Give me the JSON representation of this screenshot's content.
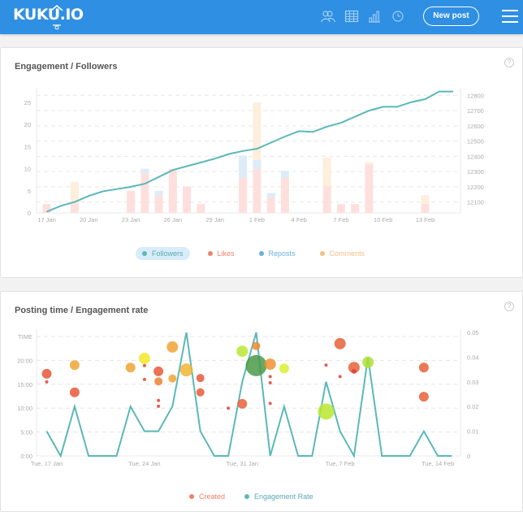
{
  "header": {
    "logo": "KUKU.IO",
    "nav_icons": [
      "users-icon",
      "calendar-icon",
      "analytics-icon",
      "clock-icon"
    ],
    "new_post_label": "New post",
    "menu_icon": "hamburger-menu-icon",
    "brand_color": "#2e8fe3"
  },
  "cards": [
    {
      "title": "Engagement / Followers",
      "help": "?"
    },
    {
      "title": "Posting time / Engagement rate",
      "help": "?"
    }
  ],
  "chart_data": [
    {
      "type": "bar",
      "title": "Engagement / Followers",
      "x_tick_labels": [
        "17 Jan",
        "20 Jan",
        "23 Jan",
        "26 Jan",
        "29 Jan",
        "1 Feb",
        "4 Feb",
        "7 Feb",
        "10 Feb",
        "13 Feb"
      ],
      "categories": [
        "17 Jan",
        "18 Jan",
        "19 Jan",
        "20 Jan",
        "21 Jan",
        "22 Jan",
        "23 Jan",
        "24 Jan",
        "25 Jan",
        "26 Jan",
        "27 Jan",
        "28 Jan",
        "29 Jan",
        "30 Jan",
        "31 Jan",
        "1 Feb",
        "2 Feb",
        "3 Feb",
        "4 Feb",
        "5 Feb",
        "6 Feb",
        "7 Feb",
        "8 Feb",
        "9 Feb",
        "10 Feb",
        "11 Feb",
        "12 Feb",
        "13 Feb",
        "14 Feb",
        "15 Feb"
      ],
      "y_left": {
        "ticks": [
          0,
          5,
          10,
          15,
          20,
          25
        ],
        "range": [
          0,
          27
        ]
      },
      "y_right": {
        "ticks": [
          12100,
          12200,
          12300,
          12400,
          12500,
          12600,
          12700,
          12800
        ],
        "range": [
          12030,
          12830
        ]
      },
      "grid": true,
      "series": [
        {
          "name": "Followers",
          "kind": "line",
          "axis": "right",
          "color": "#5bb8b8",
          "values": [
            12036,
            12075,
            12100,
            12140,
            12170,
            12185,
            12200,
            12220,
            12265,
            12310,
            12335,
            12360,
            12385,
            12415,
            12435,
            12450,
            12490,
            12530,
            12565,
            12560,
            12595,
            12620,
            12660,
            12700,
            12725,
            12725,
            12755,
            12775,
            12825,
            12825
          ]
        },
        {
          "name": "Likes",
          "kind": "stacked-bar",
          "axis": "left",
          "color": "#f08a80",
          "values": [
            2,
            0,
            2,
            0,
            0,
            0,
            5,
            9,
            4,
            10,
            6,
            2,
            0,
            0,
            8,
            10,
            3.5,
            8,
            0,
            0,
            6,
            2,
            2,
            11,
            0,
            0,
            0,
            2,
            0,
            0
          ]
        },
        {
          "name": "Reposts",
          "kind": "stacked-bar",
          "axis": "left",
          "color": "#7ab8e0",
          "values": [
            0,
            0,
            0,
            0,
            0,
            0,
            0,
            1,
            1,
            0,
            0,
            0,
            0,
            0,
            5,
            2,
            1,
            1.5,
            0,
            0,
            0,
            0,
            0,
            0,
            0,
            0,
            0,
            0,
            0,
            0
          ]
        },
        {
          "name": "Comments",
          "kind": "stacked-bar",
          "axis": "left",
          "color": "#f5c080",
          "values": [
            0,
            0,
            5,
            0,
            0,
            0,
            0,
            0,
            0,
            0,
            0,
            0,
            0,
            0,
            0,
            13,
            0,
            0,
            0,
            0,
            6.5,
            0,
            0,
            0.5,
            0,
            0,
            0,
            2,
            0,
            0
          ]
        }
      ],
      "legend": [
        {
          "label": "Followers",
          "color": "#5bb8b8",
          "text_color": "#5aa8b8",
          "active": true
        },
        {
          "label": "Likes",
          "color": "#f0806a",
          "text_color": "#f0806a",
          "active": false
        },
        {
          "label": "Reposts",
          "color": "#6ab0e0",
          "text_color": "#6ab0e0",
          "active": false
        },
        {
          "label": "Comments",
          "color": "#f5c080",
          "text_color": "#f5c080",
          "active": false
        }
      ],
      "legend_position": "bottom-center"
    },
    {
      "type": "scatter",
      "title": "Posting time / Engagement rate",
      "x_tick_labels": [
        "Tue, 17 Jan",
        "Tue, 24 Jan",
        "Tue, 31 Jan",
        "Tue, 7 Feb",
        "Tue, 14 Feb"
      ],
      "y_left": {
        "label": "TIME",
        "ticks": [
          "0:00",
          "5:00",
          "10:00",
          "15:00",
          "20:00"
        ],
        "range_hours": [
          0,
          25
        ]
      },
      "y_right": {
        "ticks": [
          "0",
          "0.01",
          "0.02",
          "0.03",
          "0.04",
          "0.05"
        ],
        "range": [
          0,
          0.05
        ]
      },
      "grid": true,
      "engagement_rate": {
        "name": "Engagement Rate",
        "color": "#5bb8b8",
        "days": [
          "17 Jan",
          "18 Jan",
          "19 Jan",
          "20 Jan",
          "21 Jan",
          "22 Jan",
          "23 Jan",
          "24 Jan",
          "25 Jan",
          "26 Jan",
          "27 Jan",
          "28 Jan",
          "29 Jan",
          "30 Jan",
          "31 Jan",
          "1 Feb",
          "2 Feb",
          "3 Feb",
          "4 Feb",
          "5 Feb",
          "6 Feb",
          "7 Feb",
          "8 Feb",
          "9 Feb",
          "10 Feb",
          "11 Feb",
          "12 Feb",
          "13 Feb",
          "14 Feb",
          "15 Feb"
        ],
        "values": [
          0.01,
          0,
          0.02,
          0,
          0,
          0,
          0.02,
          0.01,
          0.01,
          0.02,
          0.05,
          0.01,
          0,
          0,
          0.03,
          0.05,
          0,
          0.02,
          0,
          0,
          0.03,
          0.01,
          0,
          0.04,
          0,
          0,
          0,
          0.01,
          0,
          0
        ]
      },
      "created_posts": [
        {
          "day": 0,
          "hour": 17.2,
          "size": 3,
          "color": "#e8553a"
        },
        {
          "day": 0,
          "hour": 15.5,
          "size": 1,
          "color": "#d9443a"
        },
        {
          "day": 2,
          "hour": 19.0,
          "size": 3,
          "color": "#f0a535"
        },
        {
          "day": 2,
          "hour": 13.3,
          "size": 3,
          "color": "#e8583a"
        },
        {
          "day": 6,
          "hour": 18.5,
          "size": 3,
          "color": "#f0a535"
        },
        {
          "day": 7,
          "hour": 20.4,
          "size": 3.5,
          "color": "#f2e826"
        },
        {
          "day": 7,
          "hour": 18.9,
          "size": 1,
          "color": "#d9443a"
        },
        {
          "day": 7,
          "hour": 16.0,
          "size": 1,
          "color": "#d9443a"
        },
        {
          "day": 8,
          "hour": 17.7,
          "size": 3,
          "color": "#e8583a"
        },
        {
          "day": 8,
          "hour": 15.6,
          "size": 2.5,
          "color": "#f08030"
        },
        {
          "day": 8,
          "hour": 11.6,
          "size": 1,
          "color": "#d9443a"
        },
        {
          "day": 8,
          "hour": 10.4,
          "size": 1,
          "color": "#d9443a"
        },
        {
          "day": 9,
          "hour": 22.8,
          "size": 3.5,
          "color": "#f0a535"
        },
        {
          "day": 9,
          "hour": 16.2,
          "size": 2.5,
          "color": "#f0a535"
        },
        {
          "day": 10,
          "hour": 18.0,
          "size": 4,
          "color": "#f0b535"
        },
        {
          "day": 11,
          "hour": 16.3,
          "size": 2.5,
          "color": "#e8583a"
        },
        {
          "day": 11,
          "hour": 13.3,
          "size": 2.5,
          "color": "#e8583a"
        },
        {
          "day": 13,
          "hour": 10.0,
          "size": 1,
          "color": "#d9443a"
        },
        {
          "day": 14,
          "hour": 10.9,
          "size": 3,
          "color": "#e8603a"
        },
        {
          "day": 14,
          "hour": 21.9,
          "size": 3.5,
          "color": "#b8e830"
        },
        {
          "day": 15,
          "hour": 23.0,
          "size": 2.5,
          "color": "#f08a30"
        },
        {
          "day": 15,
          "hour": 18.9,
          "size": 6.5,
          "color": "#4a9a4a"
        },
        {
          "day": 16,
          "hour": 19.2,
          "size": 3.5,
          "color": "#f09030"
        },
        {
          "day": 16,
          "hour": 16.6,
          "size": 1,
          "color": "#d9443a"
        },
        {
          "day": 16,
          "hour": 15.3,
          "size": 1,
          "color": "#d9443a"
        },
        {
          "day": 16,
          "hour": 11.0,
          "size": 1,
          "color": "#d9443a"
        },
        {
          "day": 17,
          "hour": 18.3,
          "size": 3,
          "color": "#d8f030"
        },
        {
          "day": 20,
          "hour": 19.0,
          "size": 1,
          "color": "#d9443a"
        },
        {
          "day": 20,
          "hour": 9.3,
          "size": 5,
          "color": "#b8e830"
        },
        {
          "day": 21,
          "hour": 23.5,
          "size": 3.5,
          "color": "#e8603a"
        },
        {
          "day": 21,
          "hour": 16.6,
          "size": 1,
          "color": "#d9443a"
        },
        {
          "day": 22,
          "hour": 18.5,
          "size": 3.5,
          "color": "#e8603a"
        },
        {
          "day": 22,
          "hour": 17.7,
          "size": 1.5,
          "color": "#d9443a"
        },
        {
          "day": 23,
          "hour": 19.6,
          "size": 3.5,
          "color": "#b0e030"
        },
        {
          "day": 27,
          "hour": 18.5,
          "size": 3,
          "color": "#e8603a"
        },
        {
          "day": 27,
          "hour": 12.4,
          "size": 3,
          "color": "#e8603a"
        }
      ],
      "legend": [
        {
          "label": "Created",
          "color": "#f0806a",
          "text_color": "#f0806a"
        },
        {
          "label": "Engagement Rate",
          "color": "#5bb8b8",
          "text_color": "#5aa8b8"
        }
      ],
      "legend_position": "bottom-center"
    }
  ]
}
